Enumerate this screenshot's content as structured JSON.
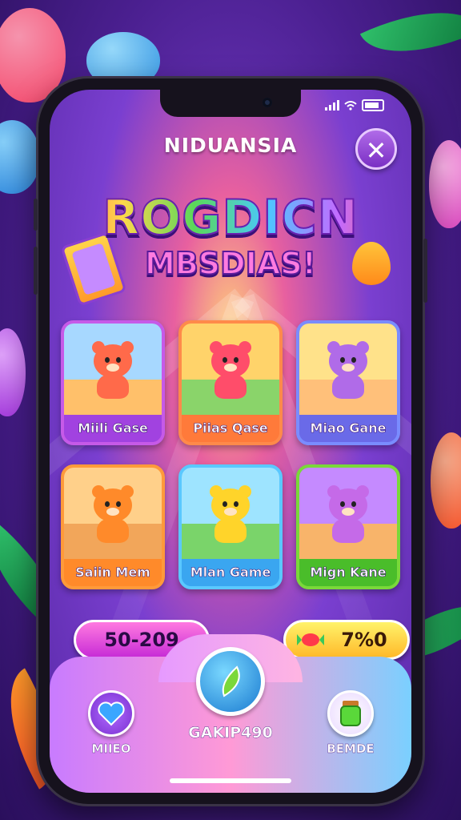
{
  "header": {
    "title": "NIDUANSIA",
    "close_icon": "close-icon"
  },
  "logo": {
    "line1": "ROGDICN",
    "line2": "MBSDIAS!"
  },
  "games": [
    {
      "label": "Miili Gase",
      "border": "#c65ae8",
      "label_bg": "#a142e0",
      "bear_color": "#ff6a4a",
      "sky": "#a7d8ff",
      "ground": "#ffc06a"
    },
    {
      "label": "Piias Qase",
      "border": "#ff8a4a",
      "label_bg": "#ff7a3a",
      "bear_color": "#ff4d6a",
      "sky": "#ffd36a",
      "ground": "#8ad46a"
    },
    {
      "label": "Miao Gane",
      "border": "#7a8cff",
      "label_bg": "#6a6ae8",
      "bear_color": "#b06be8",
      "sky": "#ffe28a",
      "ground": "#ffc07a"
    },
    {
      "label": "Saiin Mem",
      "border": "#ff9a3a",
      "label_bg": "#ff8a2a",
      "bear_color": "#ff8a2a",
      "sky": "#ffd08a",
      "ground": "#f2a65a"
    },
    {
      "label": "Mlan Game",
      "border": "#5ac8ff",
      "label_bg": "#3aa6f0",
      "bear_color": "#ffd42a",
      "sky": "#9ee4ff",
      "ground": "#7ad46a"
    },
    {
      "label": "Mign Kane",
      "border": "#7ad83a",
      "label_bg": "#4abd2a",
      "bear_color": "#c56ae8",
      "sky": "#c58aff",
      "ground": "#f8b46a"
    }
  ],
  "stats": {
    "left_value": "50-209",
    "right_value": "7%0"
  },
  "nav": {
    "left_label": "MIIEO",
    "center_label": "GAKIP490",
    "right_label": "BEMDE"
  },
  "colors": {
    "accent": "#8a3fd0",
    "pill_pink": "#e14be0",
    "pill_yellow": "#ffcf3a"
  }
}
